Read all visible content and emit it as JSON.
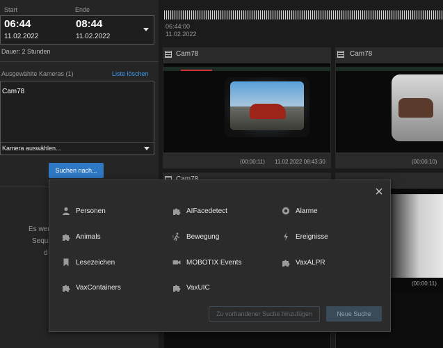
{
  "time_range": {
    "start_label": "Start",
    "end_label": "Ende",
    "start_time": "06:44",
    "start_date": "11.02.2022",
    "end_time": "08:44",
    "end_date": "11.02.2022",
    "duration": "Dauer: 2 Stunden"
  },
  "cameras": {
    "header": "Ausgewählte Kameras (1)",
    "clear_link": "Liste löschen",
    "items": [
      "Cam78"
    ],
    "select_placeholder": "Kamera auswählen..."
  },
  "search_button": "Suchen nach...",
  "hint_lines": [
    "Es wer",
    "Sequ",
    "d"
  ],
  "timeline": {
    "time": "06:44:00",
    "date": "11.02.2022"
  },
  "tiles": [
    {
      "title": "Cam78",
      "offset": "(00:00:11)",
      "timestamp": "11.02.2022 08:43:30"
    },
    {
      "title": "Cam78",
      "offset": "(00:00:10)",
      "timestamp": ""
    },
    {
      "title": "Cam78",
      "offset": "",
      "timestamp": ""
    },
    {
      "title": "",
      "offset": "(00:00:11)",
      "timestamp": ""
    }
  ],
  "search_menu": {
    "items": [
      {
        "label": "Personen",
        "icon": "person-icon"
      },
      {
        "label": "AIFacedetect",
        "icon": "puzzle-icon"
      },
      {
        "label": "Alarme",
        "icon": "alarm-icon"
      },
      {
        "label": "Animals",
        "icon": "puzzle-icon"
      },
      {
        "label": "Bewegung",
        "icon": "motion-icon"
      },
      {
        "label": "Ereignisse",
        "icon": "lightning-icon"
      },
      {
        "label": "Lesezeichen",
        "icon": "bookmark-icon"
      },
      {
        "label": "MOBOTIX Events",
        "icon": "camera-icon"
      },
      {
        "label": "VaxALPR",
        "icon": "puzzle-icon"
      },
      {
        "label": "VaxContainers",
        "icon": "puzzle-icon"
      },
      {
        "label": "VaxUIC",
        "icon": "puzzle-icon"
      }
    ],
    "add_to_existing": "Zu vorhandener Suche hinzufügen",
    "new_search": "Neue Suche"
  },
  "colors": {
    "accent": "#2f78c4",
    "link": "#3a9bef",
    "panel": "#2b2b2b",
    "background": "#1b1b1b"
  }
}
